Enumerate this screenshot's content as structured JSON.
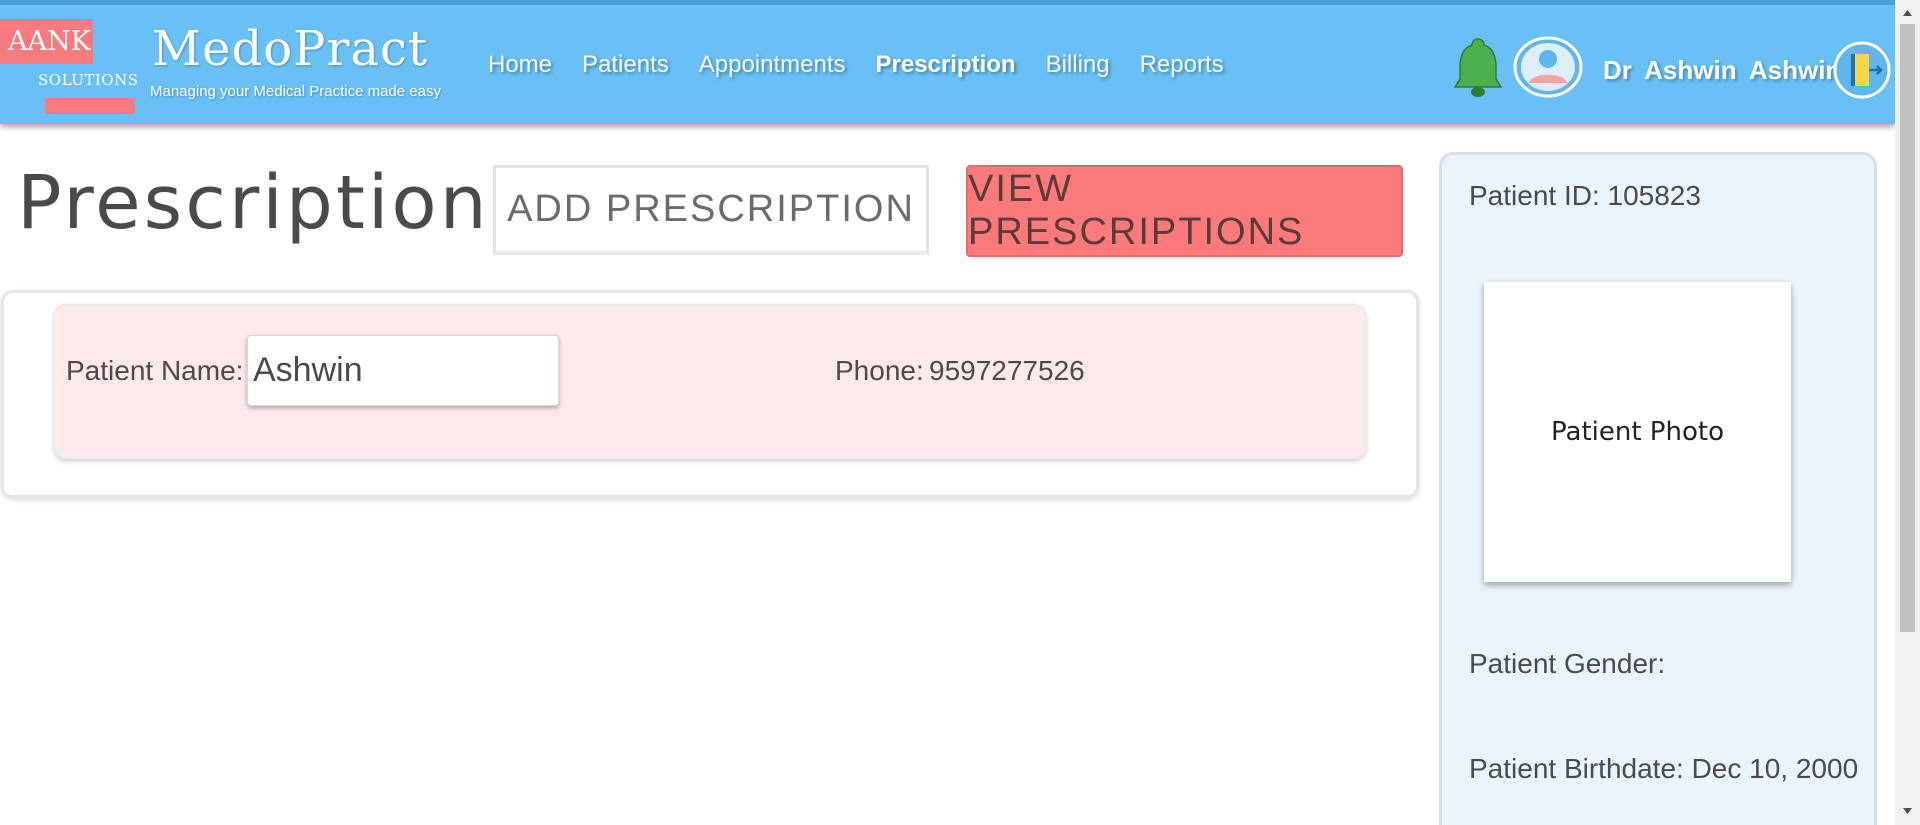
{
  "header": {
    "logo_text": "AANK",
    "logo_subtext": "SOLUTIONS",
    "brand_title": "MedoPract",
    "brand_tagline": "Managing your Medical Practice made easy",
    "nav": [
      {
        "label": "Home"
      },
      {
        "label": "Patients"
      },
      {
        "label": "Appointments"
      },
      {
        "label": "Prescription",
        "active": true
      },
      {
        "label": "Billing"
      },
      {
        "label": "Reports"
      }
    ],
    "doctor_name": "Dr Ashwin Ashwin",
    "icons": [
      "bell-icon",
      "user-avatar-icon",
      "logout-door-icon"
    ]
  },
  "page": {
    "title": "Prescriptions",
    "add_button": "ADD PRESCRIPTION",
    "view_button": "VIEW PRESCRIPTIONS"
  },
  "patient_card": {
    "name_label": "Patient Name:",
    "name_value": "Ashwin",
    "phone_label": "Phone:",
    "phone_value": "9597277526"
  },
  "side_panel": {
    "patient_id": "Patient ID: 105823",
    "photo_label": "Patient Photo",
    "gender": "Patient Gender:",
    "birthdate": "Patient Birthdate: Dec 10, 2000"
  },
  "colors": {
    "navbar": "#68c0f6",
    "accent_red": "#fd7a7a",
    "card_pink": "#fde9e9",
    "panel_blue": "#eaf4fc",
    "bell_green": "#4caf50"
  }
}
